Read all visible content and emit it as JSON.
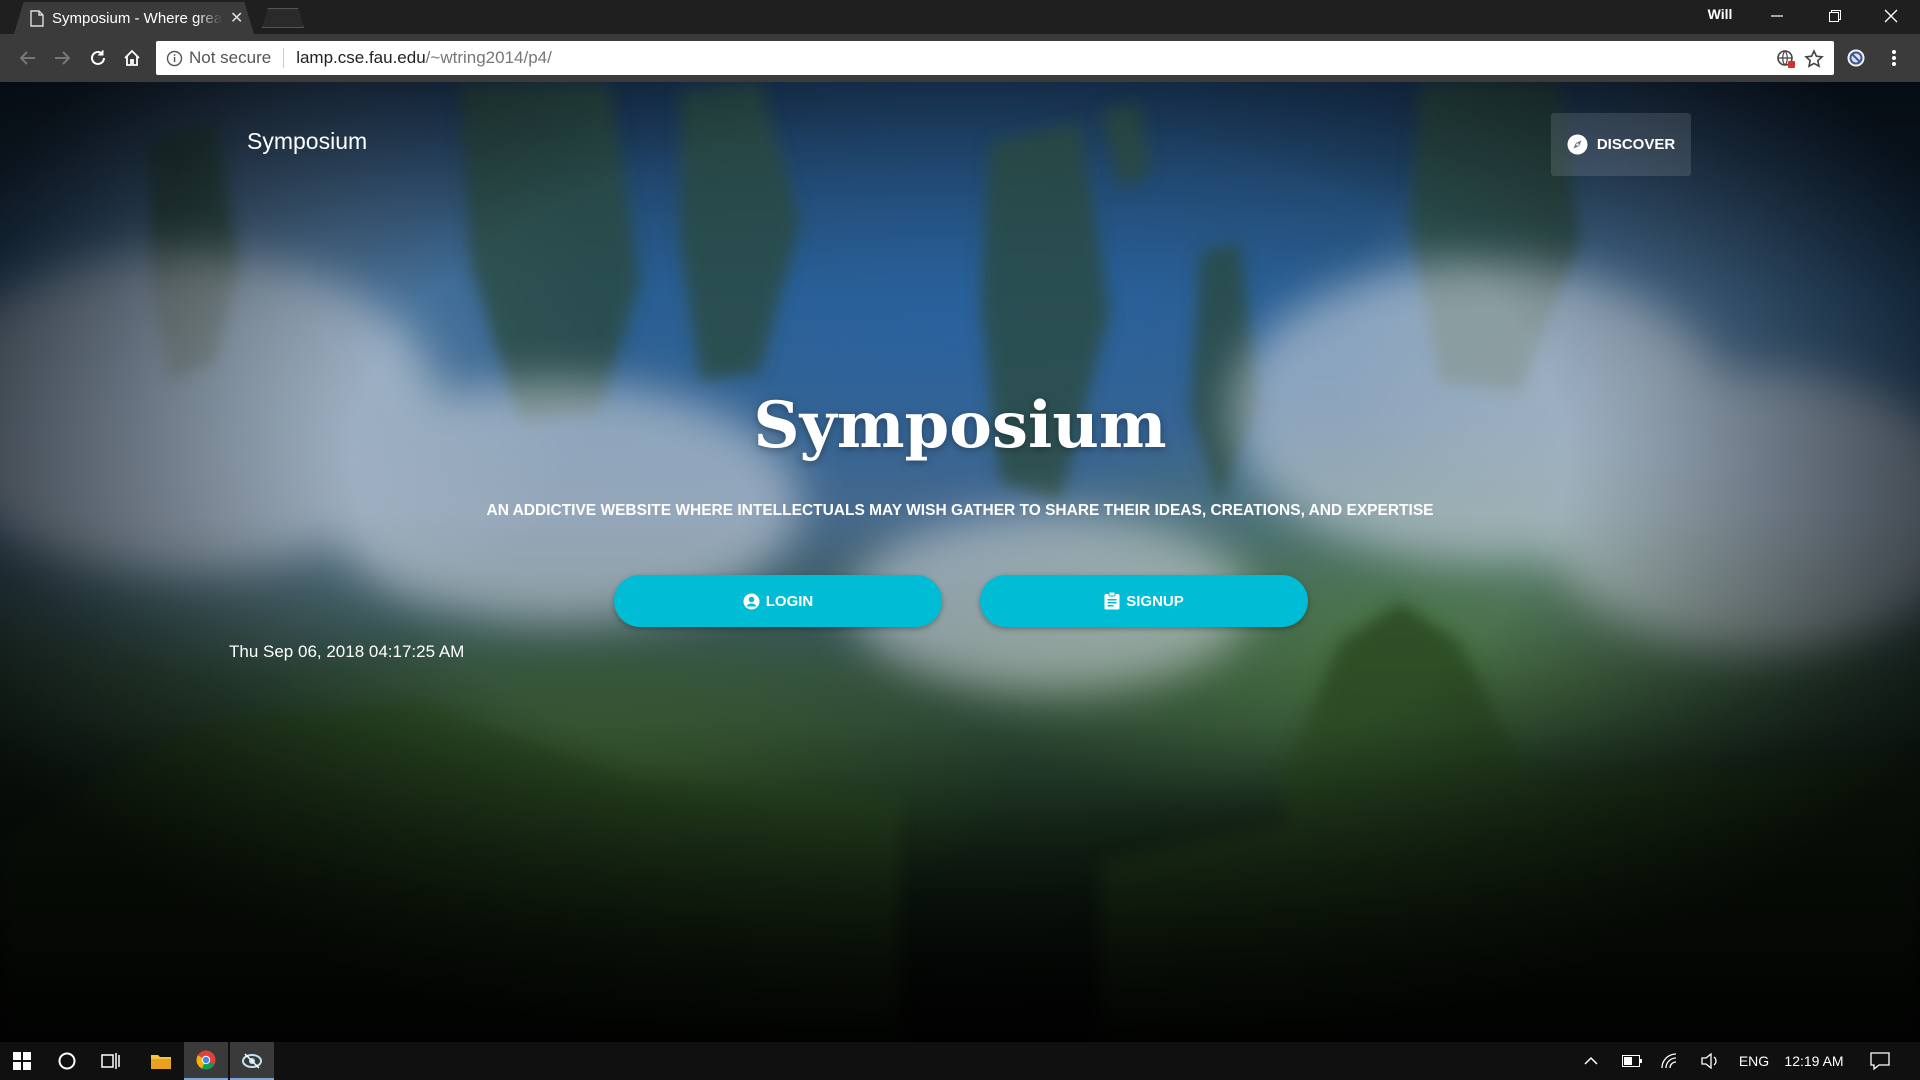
{
  "browser": {
    "tab_title": "Symposium - Where great minds gather",
    "profile_name": "Will",
    "security_label": "Not secure",
    "url_host": "lamp.cse.fau.edu",
    "url_path": "/~wtring2014/p4/"
  },
  "page": {
    "brand": "Symposium",
    "discover_label": "DISCOVER",
    "hero_title": "Symposium",
    "hero_subtitle": "AN ADDICTIVE WEBSITE WHERE INTELLECTUALS MAY WISH GATHER TO SHARE THEIR IDEAS, CREATIONS, AND EXPERTISE",
    "login_label": "LOGIN",
    "signup_label": "SIGNUP",
    "timestamp": "Thu Sep 06, 2018 04:17:25 AM",
    "accent_color": "#00bcd4"
  },
  "taskbar": {
    "language": "ENG",
    "clock": "12:19 AM"
  }
}
